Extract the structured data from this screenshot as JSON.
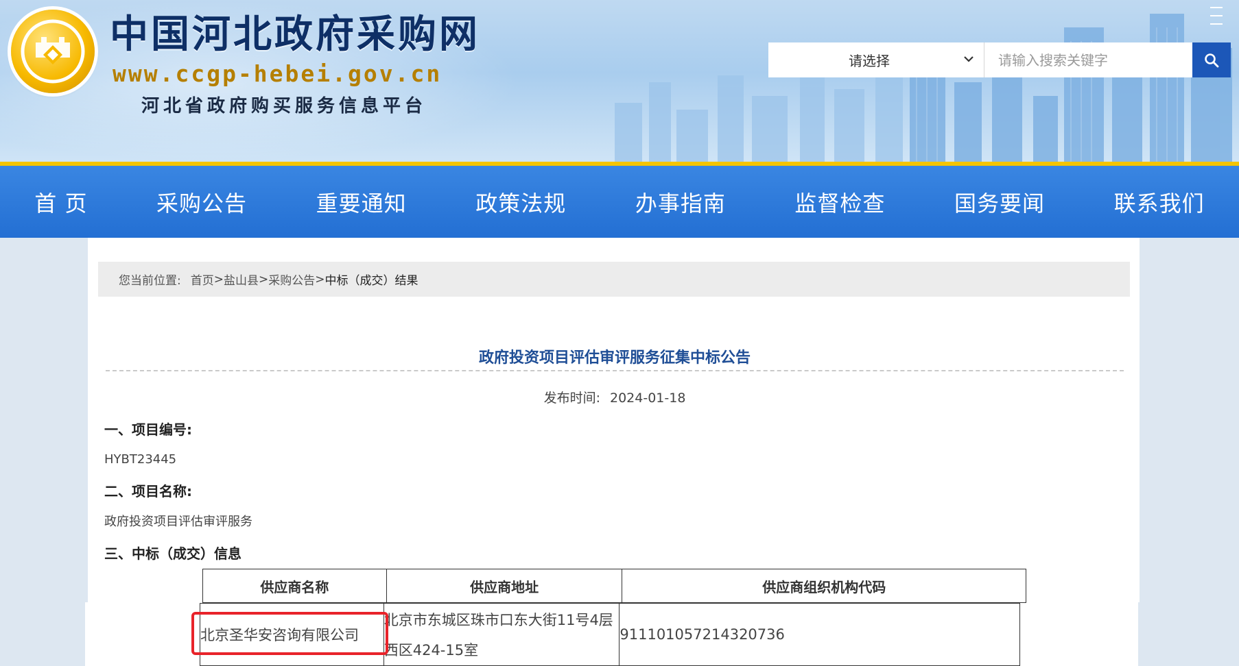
{
  "header": {
    "site_title": "中国河北政府采购网",
    "site_url": "www.ccgp-hebei.gov.cn",
    "site_subtitle": "河北省政府购买服务信息平台",
    "search": {
      "select_label": "请选择",
      "placeholder": "请输入搜索关键字",
      "button_icon": "search-icon"
    }
  },
  "nav": {
    "items": [
      "首 页",
      "采购公告",
      "重要通知",
      "政策法规",
      "办事指南",
      "监督检查",
      "国务要闻",
      "联系我们"
    ]
  },
  "breadcrumb": {
    "lead": "您当前位置:",
    "items": [
      "首页",
      "盐山县",
      "采购公告"
    ],
    "current": "中标（成交）结果",
    "separator": ">"
  },
  "article": {
    "title": "政府投资项目评估审评服务征集中标公告",
    "publish_label": "发布时间:",
    "publish_date": "2024-01-18",
    "sections": [
      {
        "heading": "一、项目编号:",
        "value": "HYBT23445"
      },
      {
        "heading": "二、项目名称:",
        "value": "政府投资项目评估审评服务"
      },
      {
        "heading": "三、中标（成交）信息",
        "value": ""
      }
    ],
    "table": {
      "headers": [
        "供应商名称",
        "供应商地址",
        "供应商组织机构代码"
      ],
      "rows": [
        {
          "name": "北京圣华安咨询有限公司",
          "address_line1": "北京市东城区珠市口东大街11号4层",
          "address_line2": "西区424-15室",
          "org_code": "911101057214320736"
        }
      ]
    }
  },
  "colors": {
    "nav_blue": "#236fd3",
    "accent_yellow": "#f5c400",
    "title_blue": "#1f4e96",
    "highlight_red": "#e8232a",
    "search_button": "#1c57b8"
  }
}
